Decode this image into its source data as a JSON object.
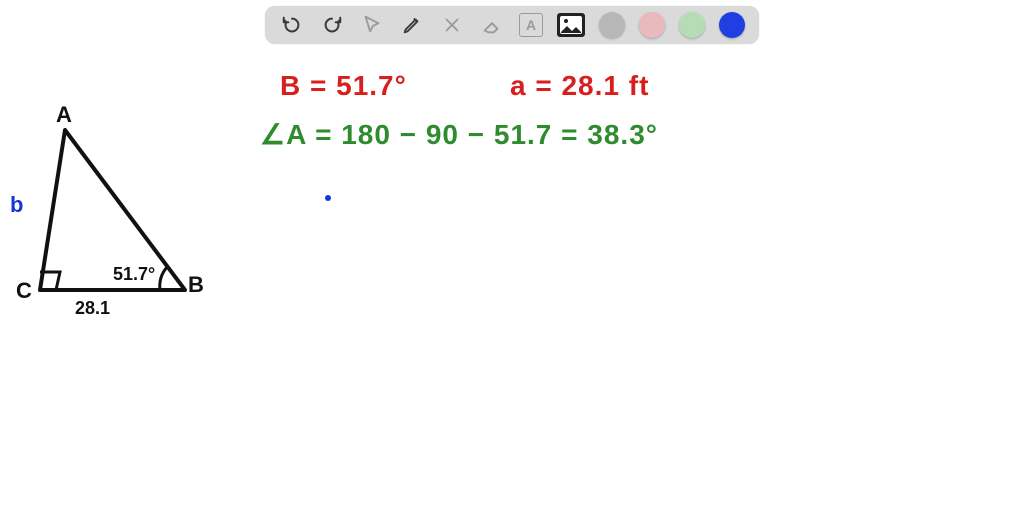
{
  "toolbar": {
    "colors": {
      "grey": "#b7b7b7",
      "pink": "#e9b9bb",
      "green": "#b6dcb6",
      "blue": "#1f3fe0"
    }
  },
  "equations": {
    "line1a": "B = 51.7°",
    "line1b": "a = 28.1 ft",
    "line2": "∠A = 180 − 90 − 51.7  =  38.3°"
  },
  "diagram": {
    "vertexA": "A",
    "vertexB": "B",
    "vertexC": "C",
    "side_b_label": "b",
    "angle_B": "51.7°",
    "side_a": "28.1"
  },
  "chart_data": {
    "type": "diagram",
    "shape": "right-triangle",
    "vertices": [
      "A",
      "B",
      "C"
    ],
    "right_angle_at": "C",
    "given": {
      "angle_B_deg": 51.7,
      "side_a_ft": 28.1
    },
    "derived": {
      "angle_A_deg": 38.3
    },
    "labels": {
      "side_b": "b"
    }
  }
}
